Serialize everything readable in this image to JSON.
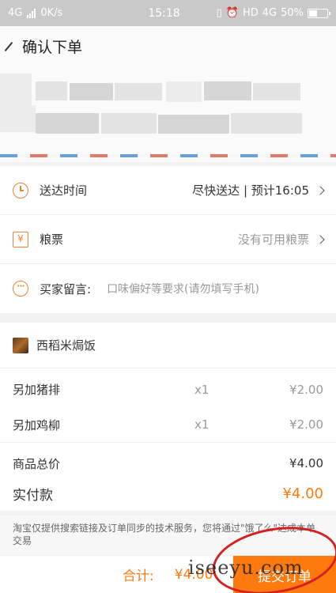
{
  "status_bar": {
    "network": "4G",
    "speed": "0K/s",
    "time": "15:18",
    "hd_label": "HD",
    "net2": "4G",
    "battery": "50%",
    "battery_level": 0.5
  },
  "header": {
    "title": "确认下单"
  },
  "delivery": {
    "label": "送达时间",
    "value": "尽快送达 | 预计16:05"
  },
  "coupon": {
    "label": "粮票",
    "value": "没有可用粮票"
  },
  "message": {
    "label": "买家留言:",
    "placeholder": "口味偏好等要求(请勿填写手机)"
  },
  "shop": {
    "name": "西稻米焗饭"
  },
  "items": [
    {
      "name": "另加猪排",
      "qty": "x1",
      "price": "¥2.00"
    },
    {
      "name": "另加鸡柳",
      "qty": "x1",
      "price": "¥2.00"
    }
  ],
  "summary": {
    "goods_total_label": "商品总价",
    "goods_total": "¥4.00",
    "pay_label": "实付款",
    "pay_total": "¥4.00"
  },
  "notice": {
    "text": "淘宝仅提供搜索链接及订单同步的技术服务，您将通过\"饿了么\"达成本单交易"
  },
  "footer": {
    "total_label": "合计:",
    "total_value": "¥4.00",
    "submit_label": "提交订单"
  },
  "watermark": {
    "text": "iseeyu.com"
  },
  "colors": {
    "accent": "#ff7a0e",
    "icon": "#e8852f"
  }
}
